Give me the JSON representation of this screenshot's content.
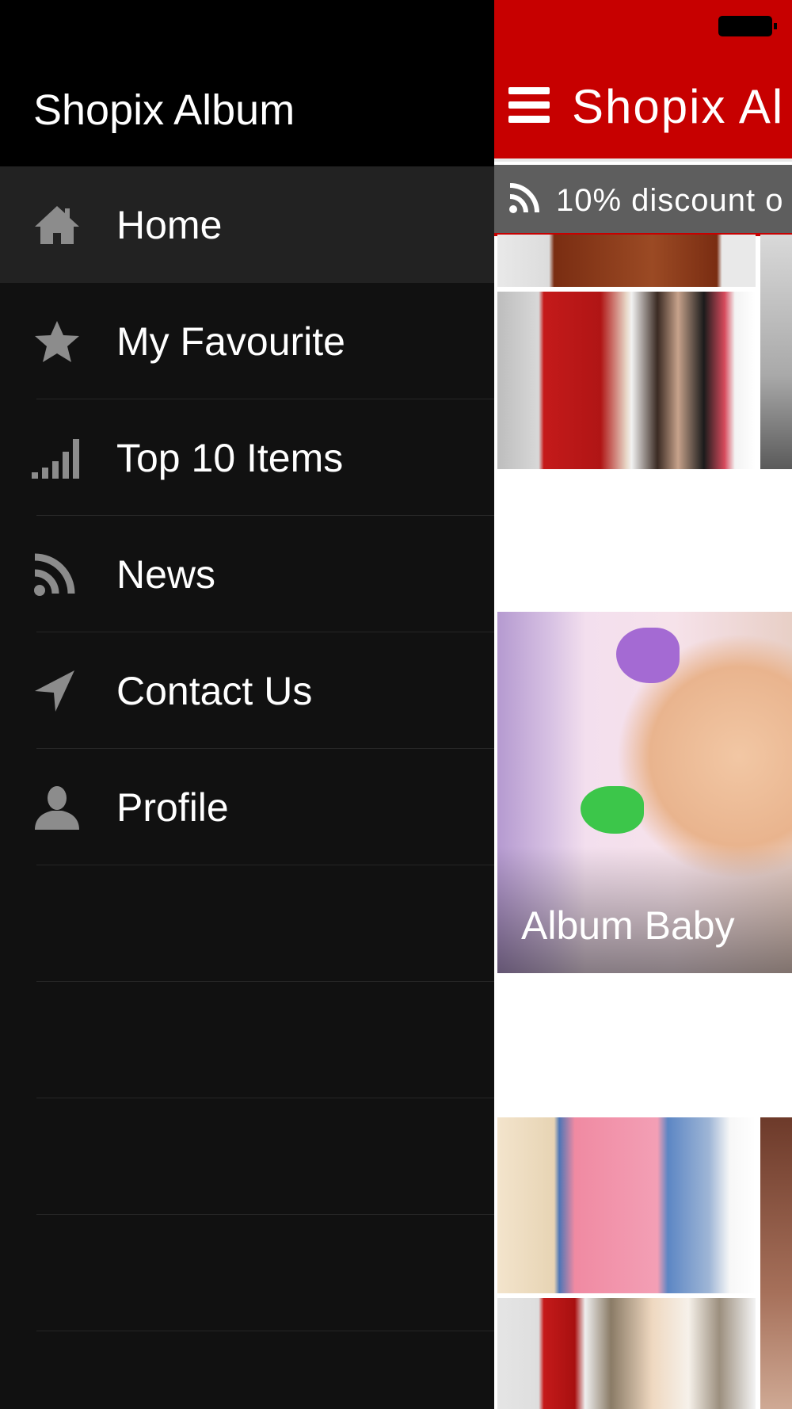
{
  "drawer": {
    "title": "Shopix Album",
    "items": [
      {
        "label": "Home",
        "icon": "home-icon",
        "active": true
      },
      {
        "label": "My Favourite",
        "icon": "star-icon",
        "active": false
      },
      {
        "label": "Top 10 Items",
        "icon": "signal-bars-icon",
        "active": false
      },
      {
        "label": "News",
        "icon": "rss-icon",
        "active": false
      },
      {
        "label": "Contact Us",
        "icon": "location-arrow-icon",
        "active": false
      },
      {
        "label": "Profile",
        "icon": "user-icon",
        "active": false
      }
    ]
  },
  "app": {
    "title": "Shopix Al",
    "ticker_text": "10% discount o",
    "albums": [
      {
        "caption": "Album Baby"
      }
    ]
  },
  "colors": {
    "accent": "#c70000",
    "drawer_bg": "#111111",
    "drawer_header_bg": "#000000",
    "active_item_bg": "#222222",
    "icon": "#8c8c8c",
    "ticker_bg": "#5e5e5e"
  }
}
